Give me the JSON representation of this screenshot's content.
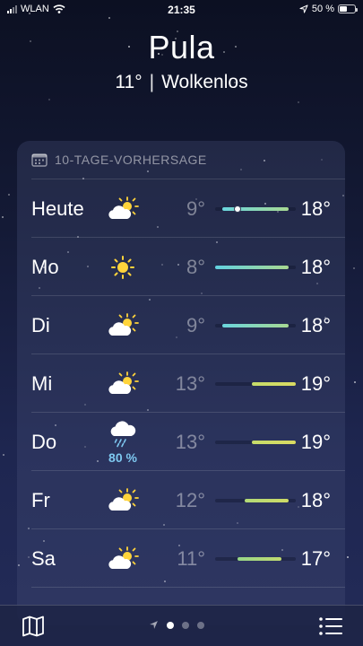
{
  "status_bar": {
    "carrier": "WLAN",
    "time": "21:35",
    "battery": "50 %"
  },
  "location": {
    "city": "Pula",
    "temperature": "11°",
    "separator": "|",
    "condition": "Wolkenlos"
  },
  "forecast": {
    "title": "10-TAGE-VORHERSAGE",
    "days": [
      {
        "day": "Heute",
        "icon": "partly-cloudy-icon",
        "low": "9°",
        "high": "18°",
        "range": [
          9,
          18
        ],
        "current": 11,
        "gradient": "linear-gradient(90deg,#6ad6de,#a7d892)"
      },
      {
        "day": "Mo",
        "icon": "sun-icon",
        "low": "8°",
        "high": "18°",
        "range": [
          8,
          18
        ],
        "gradient": "linear-gradient(90deg,#62d1e0,#a9d890)"
      },
      {
        "day": "Di",
        "icon": "partly-cloudy-icon",
        "low": "9°",
        "high": "18°",
        "range": [
          9,
          18
        ],
        "gradient": "linear-gradient(90deg,#6ad6de,#a7d892)"
      },
      {
        "day": "Mi",
        "icon": "partly-cloudy-icon",
        "low": "13°",
        "high": "19°",
        "range": [
          13,
          19
        ],
        "gradient": "linear-gradient(90deg,#c6dc6a,#dadb62)"
      },
      {
        "day": "Do",
        "icon": "rain-cloud-icon",
        "low": "13°",
        "high": "19°",
        "range": [
          13,
          19
        ],
        "precip": "80 %",
        "gradient": "linear-gradient(90deg,#c6dc6a,#dadb62)"
      },
      {
        "day": "Fr",
        "icon": "partly-cloudy-icon",
        "low": "12°",
        "high": "18°",
        "range": [
          12,
          18
        ],
        "gradient": "linear-gradient(90deg,#b2da78,#cfdb66)"
      },
      {
        "day": "Sa",
        "icon": "partly-cloudy-icon",
        "low": "11°",
        "high": "17°",
        "range": [
          11,
          17
        ],
        "gradient": "linear-gradient(90deg,#97d688,#c1da70)"
      }
    ]
  },
  "scale": {
    "min": 8,
    "max": 19
  },
  "colors": {
    "accent_precip": "#7ec8f0",
    "sun": "#ffd43b"
  },
  "bottom_bar": {
    "left_icon": "map-icon",
    "right_icon": "list-icon",
    "pages": 3,
    "active_page": 1
  }
}
